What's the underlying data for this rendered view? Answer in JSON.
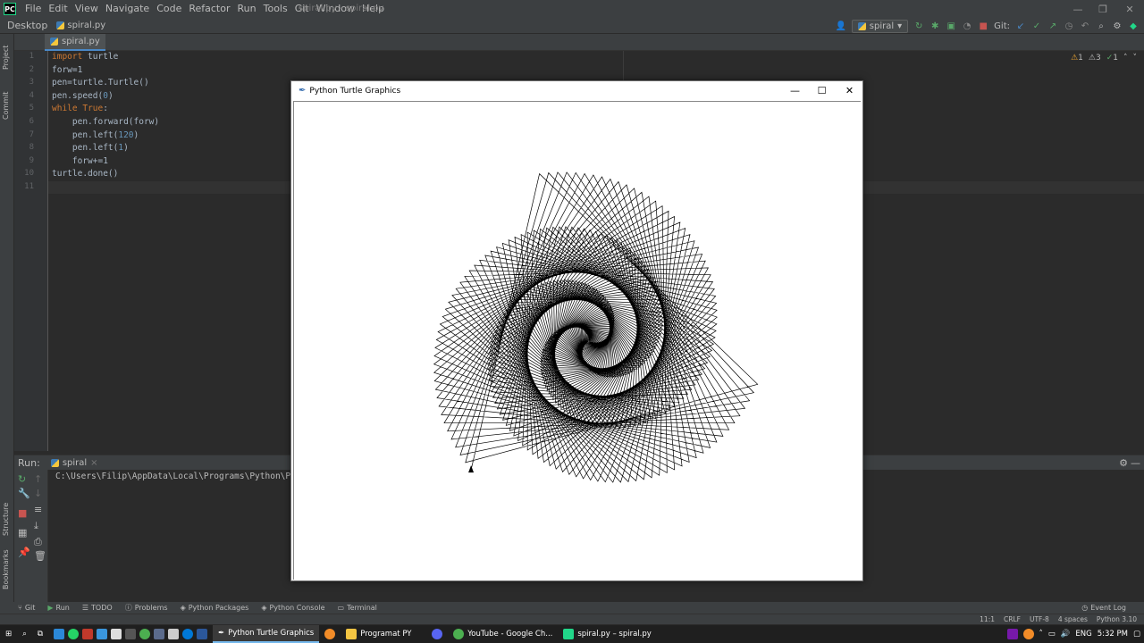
{
  "menubar": {
    "logo": "PC",
    "items": [
      "File",
      "Edit",
      "View",
      "Navigate",
      "Code",
      "Refactor",
      "Run",
      "Tools",
      "Git",
      "Window",
      "Help"
    ],
    "window_title": "spiral.py - spiral.py"
  },
  "navbar": {
    "project": "Desktop",
    "file": "spiral.py",
    "run_config": "spiral",
    "git_label": "Git:"
  },
  "left_strip": {
    "project": "Project",
    "commit": "Commit",
    "structure": "Structure",
    "bookmarks": "Bookmarks"
  },
  "editor": {
    "tab": "spiral.py",
    "lines": [
      {
        "n": "1",
        "text": "import turtle"
      },
      {
        "n": "2",
        "text": "forw=1"
      },
      {
        "n": "3",
        "text": "pen=turtle.Turtle()"
      },
      {
        "n": "4",
        "text": "pen.speed(0)"
      },
      {
        "n": "5",
        "text": "while True:"
      },
      {
        "n": "6",
        "text": "    pen.forward(forw)"
      },
      {
        "n": "7",
        "text": "    pen.left(120)"
      },
      {
        "n": "8",
        "text": "    pen.left(1)"
      },
      {
        "n": "9",
        "text": "    forw+=1"
      },
      {
        "n": "10",
        "text": "turtle.done()"
      },
      {
        "n": "11",
        "text": ""
      }
    ],
    "inspections": {
      "warnings": "1",
      "weak": "3",
      "ok": "1"
    }
  },
  "run_panel": {
    "label": "Run:",
    "config": "spiral",
    "console": "C:\\Users\\Filip\\AppData\\Local\\Programs\\Python\\Pyth"
  },
  "bottom_tools": [
    "Git",
    "Run",
    "TODO",
    "Problems",
    "Python Packages",
    "Python Console",
    "Terminal"
  ],
  "event_log": "Event Log",
  "statusbar": [
    "11:1",
    "CRLF",
    "UTF-8",
    "4 spaces",
    "Python 3.10"
  ],
  "turtle_window": {
    "title": "Python Turtle Graphics",
    "drawing": {
      "forward_start": 1,
      "turn_deg": 121,
      "step_increment": 1,
      "ink": "#000000"
    }
  },
  "taskbar": {
    "apps": [
      {
        "label": "Python Turtle Graphics",
        "active": true
      },
      {
        "label": "Programat PY",
        "active": false
      },
      {
        "label": "YouTube - Google Ch...",
        "active": false
      },
      {
        "label": "spiral.py – spiral.py",
        "active": false
      }
    ],
    "tray": {
      "lang": "ENG",
      "time": "5:32 PM"
    }
  },
  "colors": {
    "accent": "#4a88c7",
    "ide_bg": "#2b2b2b",
    "keyword": "#cc7832",
    "number": "#6897bb"
  }
}
